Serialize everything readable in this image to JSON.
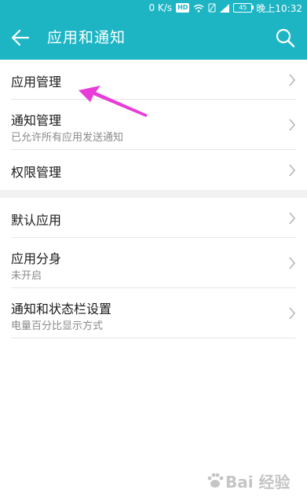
{
  "status_bar": {
    "network_speed": "0 K/s",
    "hd_badge": "HD",
    "battery_level": "45",
    "time": "晚上10:32"
  },
  "header": {
    "title": "应用和通知"
  },
  "groups": [
    {
      "items": [
        {
          "title": "应用管理",
          "subtitle": ""
        },
        {
          "title": "通知管理",
          "subtitle": "已允许所有应用发送通知"
        },
        {
          "title": "权限管理",
          "subtitle": ""
        }
      ]
    },
    {
      "items": [
        {
          "title": "默认应用",
          "subtitle": ""
        },
        {
          "title": "应用分身",
          "subtitle": "未开启"
        },
        {
          "title": "通知和状态栏设置",
          "subtitle": "电量百分比显示方式"
        }
      ]
    }
  ],
  "watermark": {
    "text": "Bai 经验"
  },
  "colors": {
    "accent": "#1db5c4",
    "annotation_arrow": "#e83cd8"
  },
  "icons": {
    "back": "arrow-left-icon",
    "search": "search-icon",
    "chevron": "chevron-right-icon"
  }
}
